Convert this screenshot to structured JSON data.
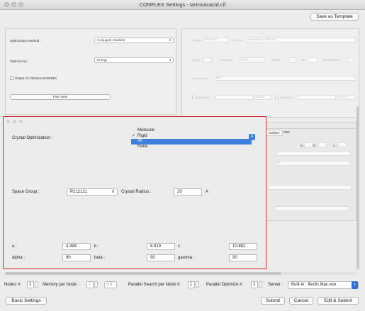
{
  "window": {
    "title": "CONFLEX Settings - tartronicacid.cif"
  },
  "toolbar": {
    "save_template": "Save as Template"
  },
  "left_panel": {
    "optimization_method_label": "Optimization Method :",
    "optimization_method_value": "Conjugate Gradient",
    "optimize_by_label": "Optimize by :",
    "optimize_by_value": "Energy",
    "output_vibrational_label": "Output All Vibrational MODEs",
    "fine_tune": "Fine Tune"
  },
  "right_panel": {
    "program_label": "Program :",
    "program_value": "GAUSSIAN",
    "job_title_label": "Job Title :",
    "job_title_value": "Generated by CONFLEX",
    "charge_label": "Charge :",
    "charge_value": "0",
    "multiplicity_label": "Multiplicity :",
    "multiplicity_value": "Singlet",
    "solvent_label": "Solvent :",
    "solvent_value": "None",
    "mb_label": "MB",
    "valence_label": "ValenceShared :",
    "valence_value": "0",
    "route_section_label": "Route Section :",
    "route_section_value": "RHF",
    "restart_file_label": "Restart File :",
    "select_label": "Select...",
    "output_file_label": "Output File :",
    "tab_surface": "Surface",
    "tab_pbc": "PBC",
    "abc_a": "a :",
    "abc_b": "b :",
    "abc_c": "c :",
    "field_50": "50",
    "field_100": "100"
  },
  "crystal_dialog": {
    "crystal_optimization_label": "Crystal Optimization :",
    "menu_options": [
      "Molecule",
      "Rigid",
      "All",
      "None"
    ],
    "checked_option": "Rigid",
    "highlighted_option": "All",
    "space_group_label": "Space Group :",
    "space_group_value": "P212121",
    "crystal_radius_label": "Crystal Radius :",
    "crystal_radius_value": "20",
    "crystal_radius_unit": "A",
    "a_label": "a :",
    "a_value": "4.494",
    "b_label": "b :",
    "b_value": "8.819",
    "c_label": "c :",
    "c_value": "10.882",
    "alpha_label": "alpha :",
    "alpha_value": "90",
    "beta_label": "beta :",
    "beta_value": "90",
    "gamma_label": "gamma :",
    "gamma_value": "90"
  },
  "bottom_bar": {
    "nodes_label": "Nodes #:",
    "nodes_value": "1",
    "memory_label": "Memory per Node :",
    "memory_value": "1",
    "memory_unit": "GB",
    "parallel_search_label": "Parallel Search per Node #:",
    "parallel_search_value": "1",
    "parallel_optimize_label": "Parallel Optimize #:",
    "parallel_optimize_value": "1",
    "server_label": "Server :",
    "server_value": "Built-in : flex8c.Mac.exe"
  },
  "actions": {
    "basic_settings": "Basic Settings",
    "submit": "Submit",
    "cancel": "Cancel",
    "edit_submit": "Edit & Submit"
  },
  "colors": {
    "highlight_border": "#d42a2a",
    "menu_selection": "#3d7fdc",
    "server_accent": "#2f6fd6"
  }
}
